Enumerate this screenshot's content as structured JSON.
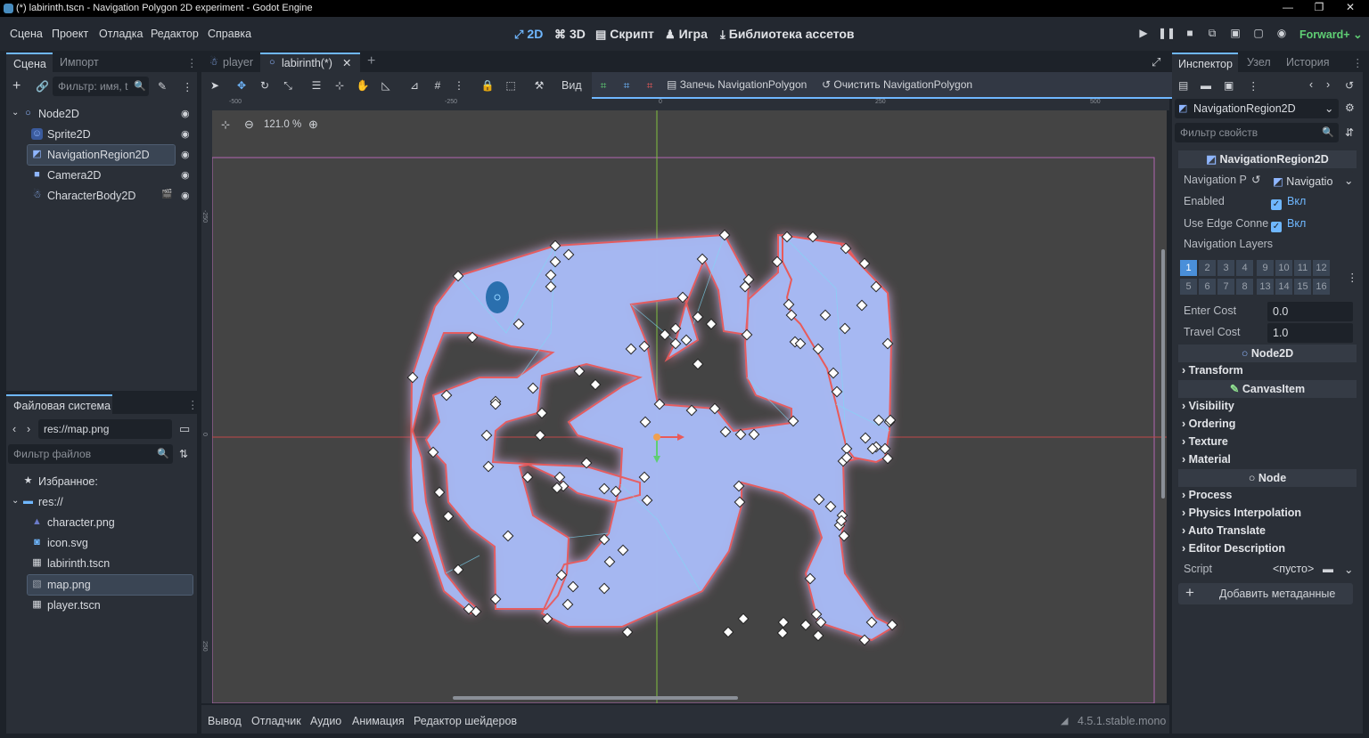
{
  "window": {
    "title": "(*) labirinth.tscn - Navigation Polygon 2D experiment - Godot Engine"
  },
  "menu": [
    "Сцена",
    "Проект",
    "Отладка",
    "Редактор",
    "Справка"
  ],
  "workspaces": [
    {
      "label": "2D",
      "icon": "2d-icon",
      "active": true
    },
    {
      "label": "3D",
      "icon": "3d-icon"
    },
    {
      "label": "Скрипт",
      "icon": "script-icon"
    },
    {
      "label": "Игра",
      "icon": "game-icon"
    },
    {
      "label": "Библиотека ассетов",
      "icon": "asset-library-icon"
    }
  ],
  "renderer": "Forward+",
  "scene_panel": {
    "tabs": [
      "Сцена",
      "Импорт"
    ],
    "filter_placeholder": "Фильтр: имя, t",
    "nodes": [
      {
        "name": "Node2D",
        "icon": "node2d-icon"
      },
      {
        "name": "Sprite2D",
        "icon": "sprite2d-icon"
      },
      {
        "name": "NavigationRegion2D",
        "icon": "navigation-region-icon",
        "selected": true
      },
      {
        "name": "Camera2D",
        "icon": "camera2d-icon"
      },
      {
        "name": "CharacterBody2D",
        "icon": "character-body-icon"
      }
    ]
  },
  "filesystem": {
    "tab": "Файловая система",
    "path": "res://map.png",
    "filter_placeholder": "Фильтр файлов",
    "favorites": "Избранное:",
    "root": "res://",
    "files": [
      {
        "name": "character.png",
        "icon": "image-icon"
      },
      {
        "name": "icon.svg",
        "icon": "svg-icon"
      },
      {
        "name": "labirinth.tscn",
        "icon": "scene-icon"
      },
      {
        "name": "map.png",
        "icon": "image-icon",
        "selected": true
      },
      {
        "name": "player.tscn",
        "icon": "scene-icon"
      }
    ]
  },
  "editor": {
    "tabs": [
      "player",
      "labirinth(*)"
    ],
    "toolbar": {
      "view_label": "Вид",
      "bake_label": "Запечь NavigationPolygon",
      "clear_label": "Очистить NavigationPolygon"
    },
    "zoom": "121.0 %",
    "ruler_labels": [
      "-500",
      "-250",
      "0",
      "250",
      "500"
    ],
    "vruler_labels": [
      "-250",
      "0",
      "250"
    ]
  },
  "bottom_panel": {
    "tabs": [
      "Вывод",
      "Отладчик",
      "Аудио",
      "Анимация",
      "Редактор шейдеров"
    ],
    "version": "4.5.1.stable.mono"
  },
  "inspector": {
    "tabs": [
      "Инспектор",
      "Узел",
      "История"
    ],
    "node_name": "NavigationRegion2D",
    "filter_placeholder": "Фильтр свойств",
    "class_header": "NavigationRegion2D",
    "properties": [
      {
        "label": "Navigation P",
        "value": "Navigatio"
      },
      {
        "label": "Enabled",
        "value": "Вкл"
      },
      {
        "label": "Use Edge Conne",
        "value": "Вкл"
      },
      {
        "label": "Navigation Layers",
        "value": ""
      }
    ],
    "layers": [
      "1",
      "2",
      "3",
      "4",
      "9",
      "10",
      "11",
      "12",
      "5",
      "6",
      "7",
      "8",
      "13",
      "14",
      "15",
      "16"
    ],
    "enter_cost": {
      "label": "Enter Cost",
      "value": "0.0"
    },
    "travel_cost": {
      "label": "Travel Cost",
      "value": "1.0"
    },
    "node2d_header": "Node2D",
    "node2d_groups": [
      "Transform"
    ],
    "canvasitem_header": "CanvasItem",
    "canvasitem_groups": [
      "Visibility",
      "Ordering",
      "Texture",
      "Material"
    ],
    "node_header": "Node",
    "node_groups": [
      "Process",
      "Physics Interpolation",
      "Auto Translate",
      "Editor Description"
    ],
    "script": {
      "label": "Script",
      "value": "<пусто>"
    },
    "add_metadata": "Добавить метаданные"
  },
  "colors": {
    "accent": "#6fb7ff",
    "renderer": "#5fce74",
    "nav_fill": "#9fb4f0",
    "nav_outline": "#e85a5a"
  }
}
